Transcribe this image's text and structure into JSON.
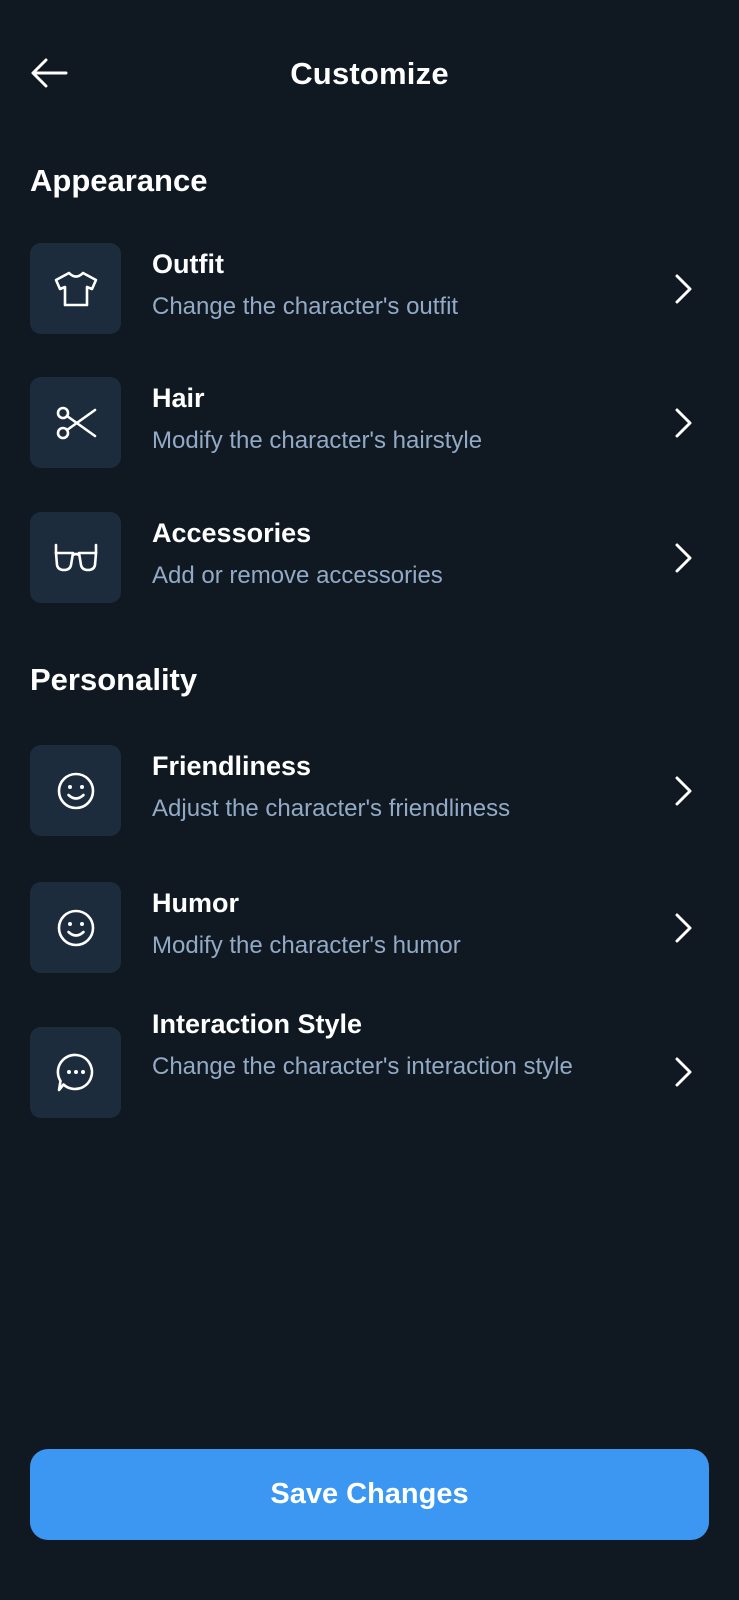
{
  "header": {
    "title": "Customize",
    "back_icon": "arrow-left-icon"
  },
  "sections": [
    {
      "title": "Appearance",
      "items": [
        {
          "title": "Outfit",
          "subtitle": "Change the character's outfit",
          "icon": "t-shirt-icon"
        },
        {
          "title": "Hair",
          "subtitle": "Modify the character's hairstyle",
          "icon": "scissors-icon"
        },
        {
          "title": "Accessories",
          "subtitle": "Add or remove accessories",
          "icon": "glasses-icon"
        }
      ]
    },
    {
      "title": "Personality",
      "items": [
        {
          "title": "Friendliness",
          "subtitle": "Adjust the character's friendliness",
          "icon": "smile-icon"
        },
        {
          "title": "Humor",
          "subtitle": "Modify the character's humor",
          "icon": "smile-icon"
        },
        {
          "title": "Interaction Style",
          "subtitle": "Change the character's interaction style",
          "icon": "chat-bubble-icon"
        }
      ]
    }
  ],
  "footer": {
    "save_label": "Save Changes"
  },
  "colors": {
    "background": "#101922",
    "icon_tile": "#1d2c3d",
    "subtitle_text": "#93aac6",
    "accent": "#3b97f1"
  }
}
